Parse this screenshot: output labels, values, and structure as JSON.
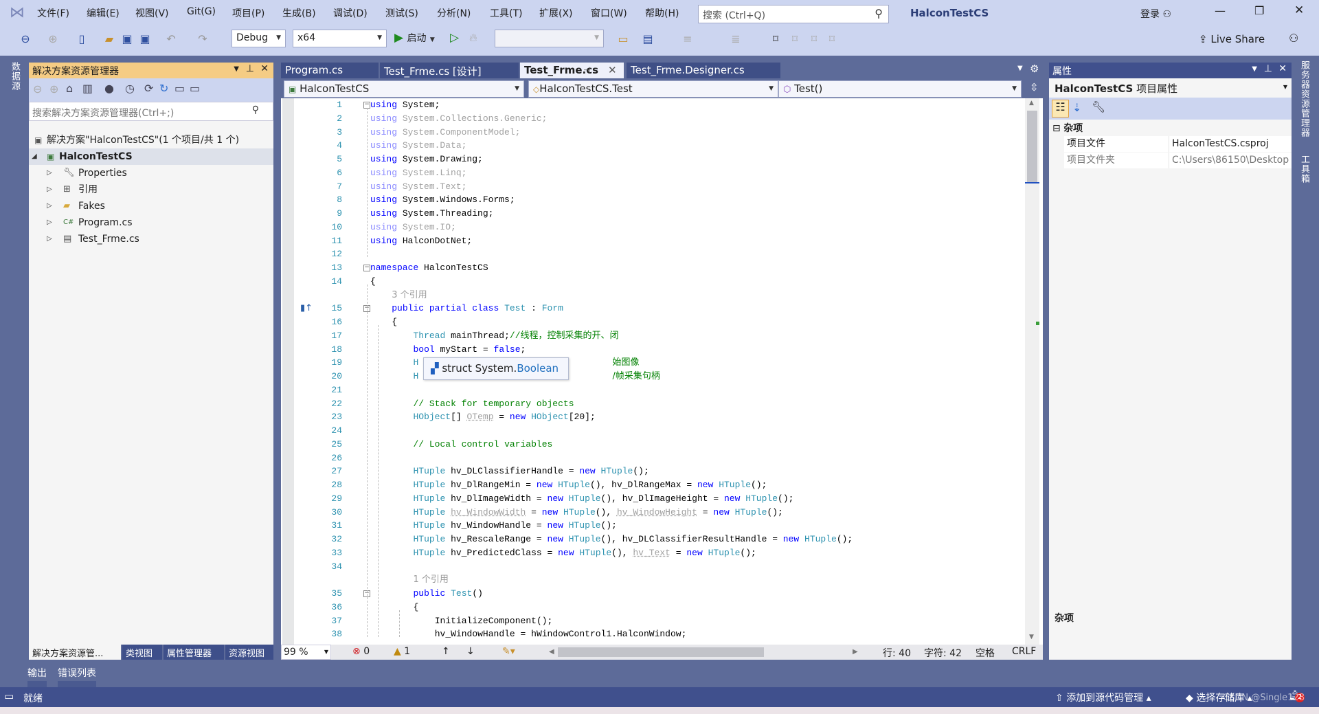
{
  "app": {
    "title": "HalconTestCS",
    "search_placeholder": "搜索 (Ctrl+Q)",
    "login": "登录",
    "live_share": "Live Share"
  },
  "menu": [
    "文件(F)",
    "编辑(E)",
    "视图(V)",
    "Git(G)",
    "项目(P)",
    "生成(B)",
    "调试(D)",
    "测试(S)",
    "分析(N)",
    "工具(T)",
    "扩展(X)",
    "窗口(W)",
    "帮助(H)"
  ],
  "toolbar": {
    "config": "Debug",
    "platform": "x64",
    "start": "启动",
    "target": ""
  },
  "left_strip": "数据源",
  "right_strip": [
    "服务器资源管理器",
    "工具箱"
  ],
  "solution_explorer": {
    "title": "解决方案资源管理器",
    "search_placeholder": "搜索解决方案资源管理器(Ctrl+;)",
    "solution": "解决方案\"HalconTestCS\"(1 个项目/共 1 个)",
    "project": "HalconTestCS",
    "items": [
      "Properties",
      "引用",
      "Fakes",
      "Program.cs",
      "Test_Frme.cs"
    ],
    "bottom_tabs": [
      "解决方案资源管...",
      "类视图",
      "属性管理器",
      "资源视图"
    ]
  },
  "editor": {
    "tabs": [
      {
        "label": "Program.cs",
        "active": false
      },
      {
        "label": "Test_Frme.cs [设计]",
        "active": false
      },
      {
        "label": "Test_Frme.cs",
        "active": true
      },
      {
        "label": "Test_Frme.Designer.cs",
        "active": false
      }
    ],
    "nav": [
      "HalconTestCS",
      "HalconTestCS.Test",
      "Test()"
    ],
    "tooltip": {
      "prefix": "struct System.",
      "type": "Boolean"
    },
    "lines": [
      {
        "n": "1",
        "i": 0,
        "f": 1,
        "tk": [
          [
            "using",
            "k"
          ],
          [
            " System;",
            "p"
          ]
        ]
      },
      {
        "n": "2",
        "i": 0,
        "tk": [
          [
            "using",
            "gk"
          ],
          [
            " System.Collections.Generic;",
            "g"
          ]
        ]
      },
      {
        "n": "3",
        "i": 0,
        "tk": [
          [
            "using",
            "gk"
          ],
          [
            " System.ComponentModel;",
            "g"
          ]
        ]
      },
      {
        "n": "4",
        "i": 0,
        "tk": [
          [
            "using",
            "gk"
          ],
          [
            " System.Data;",
            "g"
          ]
        ]
      },
      {
        "n": "5",
        "i": 0,
        "tk": [
          [
            "using",
            "k"
          ],
          [
            " System.Drawing;",
            "p"
          ]
        ]
      },
      {
        "n": "6",
        "i": 0,
        "tk": [
          [
            "using",
            "gk"
          ],
          [
            " System.Linq;",
            "g"
          ]
        ]
      },
      {
        "n": "7",
        "i": 0,
        "tk": [
          [
            "using",
            "gk"
          ],
          [
            " System.Text;",
            "g"
          ]
        ]
      },
      {
        "n": "8",
        "i": 0,
        "tk": [
          [
            "using",
            "k"
          ],
          [
            " System.Windows.Forms;",
            "p"
          ]
        ]
      },
      {
        "n": "9",
        "i": 0,
        "tk": [
          [
            "using",
            "k"
          ],
          [
            " System.Threading;",
            "p"
          ]
        ]
      },
      {
        "n": "10",
        "i": 0,
        "tk": [
          [
            "using",
            "gk"
          ],
          [
            " System.IO;",
            "g"
          ]
        ]
      },
      {
        "n": "11",
        "i": 0,
        "tk": [
          [
            "using",
            "k"
          ],
          [
            " HalconDotNet;",
            "p"
          ]
        ]
      },
      {
        "n": "12",
        "i": 0,
        "tk": []
      },
      {
        "n": "13",
        "i": 0,
        "f": 1,
        "tk": [
          [
            "namespace",
            "k"
          ],
          [
            " HalconTestCS",
            "p"
          ]
        ]
      },
      {
        "n": "14",
        "i": 0,
        "tk": [
          [
            "{",
            "p"
          ]
        ]
      },
      {
        "lens": "3 个引用",
        "i": 4
      },
      {
        "n": "15",
        "i": 4,
        "f": 1,
        "gi": 1,
        "tk": [
          [
            "public partial class ",
            "k"
          ],
          [
            "Test",
            "t"
          ],
          [
            " : ",
            "p"
          ],
          [
            "Form",
            "t"
          ]
        ]
      },
      {
        "n": "16",
        "i": 4,
        "tk": [
          [
            "{",
            "p"
          ]
        ]
      },
      {
        "n": "17",
        "i": 8,
        "tk": [
          [
            "Thread",
            "t"
          ],
          [
            " mainThread;",
            "p"
          ],
          [
            "//线程，控制采集的开、闭",
            "c"
          ]
        ]
      },
      {
        "n": "18",
        "i": 8,
        "tk": [
          [
            "bool",
            "k"
          ],
          [
            " myStart = ",
            "p"
          ],
          [
            "false",
            "k"
          ],
          [
            ";",
            "p"
          ]
        ]
      },
      {
        "n": "19",
        "i": 8,
        "tk": [
          [
            "H",
            "t"
          ],
          [
            "始图像",
            "c tipc"
          ]
        ]
      },
      {
        "n": "20",
        "i": 8,
        "tk": [
          [
            "H",
            "t"
          ],
          [
            "/帧采集句柄",
            "c tipc"
          ]
        ]
      },
      {
        "n": "21",
        "i": 8,
        "tk": []
      },
      {
        "n": "22",
        "i": 8,
        "tk": [
          [
            "// Stack for temporary objects",
            "c"
          ]
        ]
      },
      {
        "n": "23",
        "i": 8,
        "tk": [
          [
            "HObject",
            "t"
          ],
          [
            "[] ",
            "p"
          ],
          [
            "OTemp",
            "u"
          ],
          [
            " = ",
            "p"
          ],
          [
            "new",
            "k"
          ],
          [
            " ",
            "p"
          ],
          [
            "HObject",
            "t"
          ],
          [
            "[20];",
            "p"
          ]
        ]
      },
      {
        "n": "24",
        "i": 8,
        "tk": []
      },
      {
        "n": "25",
        "i": 8,
        "tk": [
          [
            "// Local control variables",
            "c"
          ]
        ]
      },
      {
        "n": "26",
        "i": 8,
        "tk": []
      },
      {
        "n": "27",
        "i": 8,
        "tk": [
          [
            "HTuple",
            "t"
          ],
          [
            " hv_DLClassifierHandle = ",
            "p"
          ],
          [
            "new",
            "k"
          ],
          [
            " ",
            "p"
          ],
          [
            "HTuple",
            "t"
          ],
          [
            "();",
            "p"
          ]
        ]
      },
      {
        "n": "28",
        "i": 8,
        "tk": [
          [
            "HTuple",
            "t"
          ],
          [
            " hv_DlRangeMin = ",
            "p"
          ],
          [
            "new",
            "k"
          ],
          [
            " ",
            "p"
          ],
          [
            "HTuple",
            "t"
          ],
          [
            "(), hv_DlRangeMax = ",
            "p"
          ],
          [
            "new",
            "k"
          ],
          [
            " ",
            "p"
          ],
          [
            "HTuple",
            "t"
          ],
          [
            "();",
            "p"
          ]
        ]
      },
      {
        "n": "29",
        "i": 8,
        "tk": [
          [
            "HTuple",
            "t"
          ],
          [
            " hv_DlImageWidth = ",
            "p"
          ],
          [
            "new",
            "k"
          ],
          [
            " ",
            "p"
          ],
          [
            "HTuple",
            "t"
          ],
          [
            "(), hv_DlImageHeight = ",
            "p"
          ],
          [
            "new",
            "k"
          ],
          [
            " ",
            "p"
          ],
          [
            "HTuple",
            "t"
          ],
          [
            "();",
            "p"
          ]
        ]
      },
      {
        "n": "30",
        "i": 8,
        "tk": [
          [
            "HTuple",
            "t"
          ],
          [
            " ",
            "p"
          ],
          [
            "hv_WindowWidth",
            "u"
          ],
          [
            " = ",
            "p"
          ],
          [
            "new",
            "k"
          ],
          [
            " ",
            "p"
          ],
          [
            "HTuple",
            "t"
          ],
          [
            "(), ",
            "p"
          ],
          [
            "hv_WindowHeight",
            "u"
          ],
          [
            " = ",
            "p"
          ],
          [
            "new",
            "k"
          ],
          [
            " ",
            "p"
          ],
          [
            "HTuple",
            "t"
          ],
          [
            "();",
            "p"
          ]
        ]
      },
      {
        "n": "31",
        "i": 8,
        "tk": [
          [
            "HTuple",
            "t"
          ],
          [
            " hv_WindowHandle = ",
            "p"
          ],
          [
            "new",
            "k"
          ],
          [
            " ",
            "p"
          ],
          [
            "HTuple",
            "t"
          ],
          [
            "();",
            "p"
          ]
        ]
      },
      {
        "n": "32",
        "i": 8,
        "tk": [
          [
            "HTuple",
            "t"
          ],
          [
            " hv_RescaleRange = ",
            "p"
          ],
          [
            "new",
            "k"
          ],
          [
            " ",
            "p"
          ],
          [
            "HTuple",
            "t"
          ],
          [
            "(), hv_DLClassifierResultHandle = ",
            "p"
          ],
          [
            "new",
            "k"
          ],
          [
            " ",
            "p"
          ],
          [
            "HTuple",
            "t"
          ],
          [
            "();",
            "p"
          ]
        ]
      },
      {
        "n": "33",
        "i": 8,
        "tk": [
          [
            "HTuple",
            "t"
          ],
          [
            " hv_PredictedClass = ",
            "p"
          ],
          [
            "new",
            "k"
          ],
          [
            " ",
            "p"
          ],
          [
            "HTuple",
            "t"
          ],
          [
            "(), ",
            "p"
          ],
          [
            "hv_Text",
            "u"
          ],
          [
            " = ",
            "p"
          ],
          [
            "new",
            "k"
          ],
          [
            " ",
            "p"
          ],
          [
            "HTuple",
            "t"
          ],
          [
            "();",
            "p"
          ]
        ]
      },
      {
        "n": "34",
        "i": 8,
        "tk": []
      },
      {
        "lens": "1 个引用",
        "i": 8
      },
      {
        "n": "35",
        "i": 8,
        "f": 1,
        "tk": [
          [
            "public",
            "k"
          ],
          [
            " ",
            "p"
          ],
          [
            "Test",
            "t"
          ],
          [
            "()",
            "p"
          ]
        ]
      },
      {
        "n": "36",
        "i": 8,
        "tk": [
          [
            "{",
            "p"
          ]
        ]
      },
      {
        "n": "37",
        "i": 12,
        "tk": [
          [
            "InitializeComponent();",
            "p"
          ]
        ]
      },
      {
        "n": "38",
        "i": 12,
        "tk": [
          [
            "hv_WindowHandle = hWindowControl1.HalconWindow;",
            "p"
          ]
        ]
      }
    ],
    "status": {
      "zoom": "99 %",
      "errors": "0",
      "warnings": "1",
      "line": "行: 40",
      "char": "字符: 42",
      "spaces": "空格",
      "eol": "CRLF"
    }
  },
  "properties": {
    "title": "属性",
    "object": "HalconTestCS",
    "object_type": "项目属性",
    "category": "杂项",
    "rows": [
      {
        "name": "项目文件",
        "value": "HalconTestCS.csproj",
        "dim": false
      },
      {
        "name": "项目文件夹",
        "value": "C:\\Users\\86150\\Desktop",
        "dim": true
      }
    ],
    "description": "杂项"
  },
  "bottom_tabs": [
    "输出",
    "错误列表"
  ],
  "statusbar": {
    "ready": "就绪",
    "source_control": "添加到源代码管理",
    "repo": "选择存储库",
    "notifications": "2",
    "watermark": "CSDN @Single128"
  },
  "colors": {
    "accent": "#40508d",
    "panel_header": "#f5cc84",
    "background": "#5d6b99"
  }
}
